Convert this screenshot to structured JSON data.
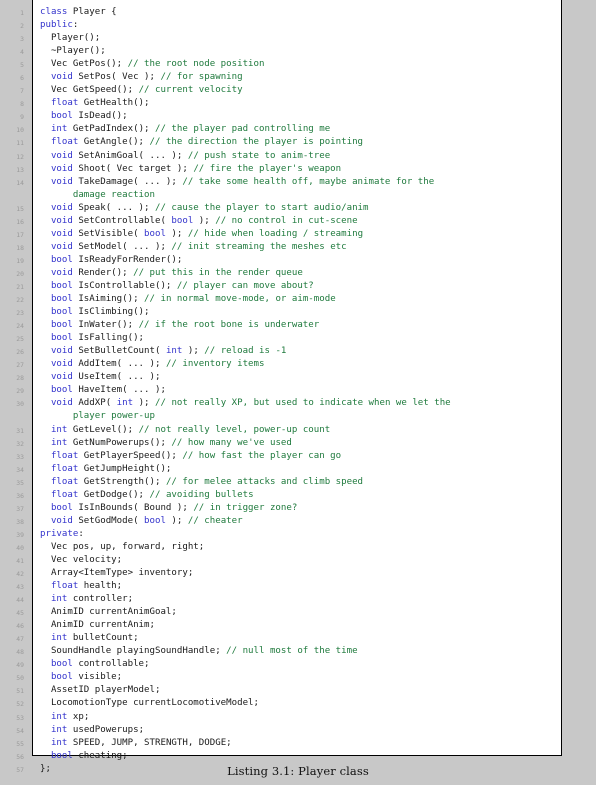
{
  "document": {
    "type": "code-listing",
    "language": "cpp",
    "caption": "Listing 3.1: Player class",
    "caption_label": "Listing 3.1:",
    "caption_title": "Player class",
    "page_background": "#c8c8c8",
    "listing_background": "#ffffff",
    "keyword_color": "#3333cc",
    "comment_color": "#1f7a3d",
    "text_color": "#1a1a1a",
    "lineno_color": "#9a9a9a",
    "first_line_number": 1,
    "last_line_number": 57
  },
  "code": {
    "lines": [
      {
        "n": "1",
        "tokens": [
          {
            "t": "kw",
            "s": "class"
          },
          {
            "t": "pl",
            "s": " Player {"
          }
        ]
      },
      {
        "n": "2",
        "tokens": [
          {
            "t": "kw",
            "s": "public"
          },
          {
            "t": "pl",
            "s": ":"
          }
        ]
      },
      {
        "n": "3",
        "tokens": [
          {
            "t": "pl",
            "s": "  Player();"
          }
        ]
      },
      {
        "n": "4",
        "tokens": [
          {
            "t": "pl",
            "s": "  ~Player();"
          }
        ]
      },
      {
        "n": "5",
        "tokens": [
          {
            "t": "pl",
            "s": "  Vec GetPos(); "
          },
          {
            "t": "cm",
            "s": "// the root node position"
          }
        ]
      },
      {
        "n": "6",
        "tokens": [
          {
            "t": "pl",
            "s": "  "
          },
          {
            "t": "kw",
            "s": "void"
          },
          {
            "t": "pl",
            "s": " SetPos( Vec ); "
          },
          {
            "t": "cm",
            "s": "// for spawning"
          }
        ]
      },
      {
        "n": "7",
        "tokens": [
          {
            "t": "pl",
            "s": "  Vec GetSpeed(); "
          },
          {
            "t": "cm",
            "s": "// current velocity"
          }
        ]
      },
      {
        "n": "8",
        "tokens": [
          {
            "t": "pl",
            "s": "  "
          },
          {
            "t": "kw",
            "s": "float"
          },
          {
            "t": "pl",
            "s": " GetHealth();"
          }
        ]
      },
      {
        "n": "9",
        "tokens": [
          {
            "t": "pl",
            "s": "  "
          },
          {
            "t": "kw",
            "s": "bool"
          },
          {
            "t": "pl",
            "s": " IsDead();"
          }
        ]
      },
      {
        "n": "10",
        "tokens": [
          {
            "t": "pl",
            "s": "  "
          },
          {
            "t": "kw",
            "s": "int"
          },
          {
            "t": "pl",
            "s": " GetPadIndex(); "
          },
          {
            "t": "cm",
            "s": "// the player pad controlling me"
          }
        ]
      },
      {
        "n": "11",
        "tokens": [
          {
            "t": "pl",
            "s": "  "
          },
          {
            "t": "kw",
            "s": "float"
          },
          {
            "t": "pl",
            "s": " GetAngle(); "
          },
          {
            "t": "cm",
            "s": "// the direction the player is pointing"
          }
        ]
      },
      {
        "n": "12",
        "tokens": [
          {
            "t": "pl",
            "s": "  "
          },
          {
            "t": "kw",
            "s": "void"
          },
          {
            "t": "pl",
            "s": " SetAnimGoal( ... ); "
          },
          {
            "t": "cm",
            "s": "// push state to anim-tree"
          }
        ]
      },
      {
        "n": "13",
        "tokens": [
          {
            "t": "pl",
            "s": "  "
          },
          {
            "t": "kw",
            "s": "void"
          },
          {
            "t": "pl",
            "s": " Shoot( Vec target ); "
          },
          {
            "t": "cm",
            "s": "// fire the player's weapon"
          }
        ]
      },
      {
        "n": "14",
        "tokens": [
          {
            "t": "pl",
            "s": "  "
          },
          {
            "t": "kw",
            "s": "void"
          },
          {
            "t": "pl",
            "s": " TakeDamage( ... ); "
          },
          {
            "t": "cm",
            "s": "// take some health off, maybe animate for the"
          }
        ]
      },
      {
        "n": "",
        "tokens": [
          {
            "t": "cm",
            "s": "      damage reaction"
          }
        ]
      },
      {
        "n": "15",
        "tokens": [
          {
            "t": "pl",
            "s": "  "
          },
          {
            "t": "kw",
            "s": "void"
          },
          {
            "t": "pl",
            "s": " Speak( ... ); "
          },
          {
            "t": "cm",
            "s": "// cause the player to start audio/anim"
          }
        ]
      },
      {
        "n": "16",
        "tokens": [
          {
            "t": "pl",
            "s": "  "
          },
          {
            "t": "kw",
            "s": "void"
          },
          {
            "t": "pl",
            "s": " SetControllable( "
          },
          {
            "t": "kw",
            "s": "bool"
          },
          {
            "t": "pl",
            "s": " ); "
          },
          {
            "t": "cm",
            "s": "// no control in cut-scene"
          }
        ]
      },
      {
        "n": "17",
        "tokens": [
          {
            "t": "pl",
            "s": "  "
          },
          {
            "t": "kw",
            "s": "void"
          },
          {
            "t": "pl",
            "s": " SetVisible( "
          },
          {
            "t": "kw",
            "s": "bool"
          },
          {
            "t": "pl",
            "s": " ); "
          },
          {
            "t": "cm",
            "s": "// hide when loading / streaming"
          }
        ]
      },
      {
        "n": "18",
        "tokens": [
          {
            "t": "pl",
            "s": "  "
          },
          {
            "t": "kw",
            "s": "void"
          },
          {
            "t": "pl",
            "s": " SetModel( ... ); "
          },
          {
            "t": "cm",
            "s": "// init streaming the meshes etc"
          }
        ]
      },
      {
        "n": "19",
        "tokens": [
          {
            "t": "pl",
            "s": "  "
          },
          {
            "t": "kw",
            "s": "bool"
          },
          {
            "t": "pl",
            "s": " IsReadyForRender();"
          }
        ]
      },
      {
        "n": "20",
        "tokens": [
          {
            "t": "pl",
            "s": "  "
          },
          {
            "t": "kw",
            "s": "void"
          },
          {
            "t": "pl",
            "s": " Render(); "
          },
          {
            "t": "cm",
            "s": "// put this in the render queue"
          }
        ]
      },
      {
        "n": "21",
        "tokens": [
          {
            "t": "pl",
            "s": "  "
          },
          {
            "t": "kw",
            "s": "bool"
          },
          {
            "t": "pl",
            "s": " IsControllable(); "
          },
          {
            "t": "cm",
            "s": "// player can move about?"
          }
        ]
      },
      {
        "n": "22",
        "tokens": [
          {
            "t": "pl",
            "s": "  "
          },
          {
            "t": "kw",
            "s": "bool"
          },
          {
            "t": "pl",
            "s": " IsAiming(); "
          },
          {
            "t": "cm",
            "s": "// in normal move-mode, or aim-mode"
          }
        ]
      },
      {
        "n": "23",
        "tokens": [
          {
            "t": "pl",
            "s": "  "
          },
          {
            "t": "kw",
            "s": "bool"
          },
          {
            "t": "pl",
            "s": " IsClimbing();"
          }
        ]
      },
      {
        "n": "24",
        "tokens": [
          {
            "t": "pl",
            "s": "  "
          },
          {
            "t": "kw",
            "s": "bool"
          },
          {
            "t": "pl",
            "s": " InWater(); "
          },
          {
            "t": "cm",
            "s": "// if the root bone is underwater"
          }
        ]
      },
      {
        "n": "25",
        "tokens": [
          {
            "t": "pl",
            "s": "  "
          },
          {
            "t": "kw",
            "s": "bool"
          },
          {
            "t": "pl",
            "s": " IsFalling();"
          }
        ]
      },
      {
        "n": "26",
        "tokens": [
          {
            "t": "pl",
            "s": "  "
          },
          {
            "t": "kw",
            "s": "void"
          },
          {
            "t": "pl",
            "s": " SetBulletCount( "
          },
          {
            "t": "kw",
            "s": "int"
          },
          {
            "t": "pl",
            "s": " ); "
          },
          {
            "t": "cm",
            "s": "// reload is -1"
          }
        ]
      },
      {
        "n": "27",
        "tokens": [
          {
            "t": "pl",
            "s": "  "
          },
          {
            "t": "kw",
            "s": "void"
          },
          {
            "t": "pl",
            "s": " AddItem( ... ); "
          },
          {
            "t": "cm",
            "s": "// inventory items"
          }
        ]
      },
      {
        "n": "28",
        "tokens": [
          {
            "t": "pl",
            "s": "  "
          },
          {
            "t": "kw",
            "s": "void"
          },
          {
            "t": "pl",
            "s": " UseItem( ... );"
          }
        ]
      },
      {
        "n": "29",
        "tokens": [
          {
            "t": "pl",
            "s": "  "
          },
          {
            "t": "kw",
            "s": "bool"
          },
          {
            "t": "pl",
            "s": " HaveItem( ... );"
          }
        ]
      },
      {
        "n": "30",
        "tokens": [
          {
            "t": "pl",
            "s": "  "
          },
          {
            "t": "kw",
            "s": "void"
          },
          {
            "t": "pl",
            "s": " AddXP( "
          },
          {
            "t": "kw",
            "s": "int"
          },
          {
            "t": "pl",
            "s": " ); "
          },
          {
            "t": "cm",
            "s": "// not really XP, but used to indicate when we let the"
          }
        ]
      },
      {
        "n": "",
        "tokens": [
          {
            "t": "cm",
            "s": "      player power-up"
          }
        ]
      },
      {
        "n": "31",
        "tokens": [
          {
            "t": "pl",
            "s": "  "
          },
          {
            "t": "kw",
            "s": "int"
          },
          {
            "t": "pl",
            "s": " GetLevel(); "
          },
          {
            "t": "cm",
            "s": "// not really level, power-up count"
          }
        ]
      },
      {
        "n": "32",
        "tokens": [
          {
            "t": "pl",
            "s": "  "
          },
          {
            "t": "kw",
            "s": "int"
          },
          {
            "t": "pl",
            "s": " GetNumPowerups(); "
          },
          {
            "t": "cm",
            "s": "// how many we've used"
          }
        ]
      },
      {
        "n": "33",
        "tokens": [
          {
            "t": "pl",
            "s": "  "
          },
          {
            "t": "kw",
            "s": "float"
          },
          {
            "t": "pl",
            "s": " GetPlayerSpeed(); "
          },
          {
            "t": "cm",
            "s": "// how fast the player can go"
          }
        ]
      },
      {
        "n": "34",
        "tokens": [
          {
            "t": "pl",
            "s": "  "
          },
          {
            "t": "kw",
            "s": "float"
          },
          {
            "t": "pl",
            "s": " GetJumpHeight();"
          }
        ]
      },
      {
        "n": "35",
        "tokens": [
          {
            "t": "pl",
            "s": "  "
          },
          {
            "t": "kw",
            "s": "float"
          },
          {
            "t": "pl",
            "s": " GetStrength(); "
          },
          {
            "t": "cm",
            "s": "// for melee attacks and climb speed"
          }
        ]
      },
      {
        "n": "36",
        "tokens": [
          {
            "t": "pl",
            "s": "  "
          },
          {
            "t": "kw",
            "s": "float"
          },
          {
            "t": "pl",
            "s": " GetDodge(); "
          },
          {
            "t": "cm",
            "s": "// avoiding bullets"
          }
        ]
      },
      {
        "n": "37",
        "tokens": [
          {
            "t": "pl",
            "s": "  "
          },
          {
            "t": "kw",
            "s": "bool"
          },
          {
            "t": "pl",
            "s": " IsInBounds( Bound ); "
          },
          {
            "t": "cm",
            "s": "// in trigger zone?"
          }
        ]
      },
      {
        "n": "38",
        "tokens": [
          {
            "t": "pl",
            "s": "  "
          },
          {
            "t": "kw",
            "s": "void"
          },
          {
            "t": "pl",
            "s": " SetGodMode( "
          },
          {
            "t": "kw",
            "s": "bool"
          },
          {
            "t": "pl",
            "s": " ); "
          },
          {
            "t": "cm",
            "s": "// cheater"
          }
        ]
      },
      {
        "n": "39",
        "tokens": [
          {
            "t": "kw",
            "s": "private"
          },
          {
            "t": "pl",
            "s": ":"
          }
        ]
      },
      {
        "n": "40",
        "tokens": [
          {
            "t": "pl",
            "s": "  Vec pos, up, forward, right;"
          }
        ]
      },
      {
        "n": "41",
        "tokens": [
          {
            "t": "pl",
            "s": "  Vec velocity;"
          }
        ]
      },
      {
        "n": "42",
        "tokens": [
          {
            "t": "pl",
            "s": "  Array<ItemType> inventory;"
          }
        ]
      },
      {
        "n": "43",
        "tokens": [
          {
            "t": "pl",
            "s": "  "
          },
          {
            "t": "kw",
            "s": "float"
          },
          {
            "t": "pl",
            "s": " health;"
          }
        ]
      },
      {
        "n": "44",
        "tokens": [
          {
            "t": "pl",
            "s": "  "
          },
          {
            "t": "kw",
            "s": "int"
          },
          {
            "t": "pl",
            "s": " controller;"
          }
        ]
      },
      {
        "n": "45",
        "tokens": [
          {
            "t": "pl",
            "s": "  AnimID currentAnimGoal;"
          }
        ]
      },
      {
        "n": "46",
        "tokens": [
          {
            "t": "pl",
            "s": "  AnimID currentAnim;"
          }
        ]
      },
      {
        "n": "47",
        "tokens": [
          {
            "t": "pl",
            "s": "  "
          },
          {
            "t": "kw",
            "s": "int"
          },
          {
            "t": "pl",
            "s": " bulletCount;"
          }
        ]
      },
      {
        "n": "48",
        "tokens": [
          {
            "t": "pl",
            "s": "  SoundHandle playingSoundHandle; "
          },
          {
            "t": "cm",
            "s": "// null most of the time"
          }
        ]
      },
      {
        "n": "49",
        "tokens": [
          {
            "t": "pl",
            "s": "  "
          },
          {
            "t": "kw",
            "s": "bool"
          },
          {
            "t": "pl",
            "s": " controllable;"
          }
        ]
      },
      {
        "n": "50",
        "tokens": [
          {
            "t": "pl",
            "s": "  "
          },
          {
            "t": "kw",
            "s": "bool"
          },
          {
            "t": "pl",
            "s": " visible;"
          }
        ]
      },
      {
        "n": "51",
        "tokens": [
          {
            "t": "pl",
            "s": "  AssetID playerModel;"
          }
        ]
      },
      {
        "n": "52",
        "tokens": [
          {
            "t": "pl",
            "s": "  LocomotionType currentLocomotiveModel;"
          }
        ]
      },
      {
        "n": "53",
        "tokens": [
          {
            "t": "pl",
            "s": "  "
          },
          {
            "t": "kw",
            "s": "int"
          },
          {
            "t": "pl",
            "s": " xp;"
          }
        ]
      },
      {
        "n": "54",
        "tokens": [
          {
            "t": "pl",
            "s": "  "
          },
          {
            "t": "kw",
            "s": "int"
          },
          {
            "t": "pl",
            "s": " usedPowerups;"
          }
        ]
      },
      {
        "n": "55",
        "tokens": [
          {
            "t": "pl",
            "s": "  "
          },
          {
            "t": "kw",
            "s": "int"
          },
          {
            "t": "pl",
            "s": " SPEED, JUMP, STRENGTH, DODGE;"
          }
        ]
      },
      {
        "n": "56",
        "tokens": [
          {
            "t": "pl",
            "s": "  "
          },
          {
            "t": "kw",
            "s": "bool"
          },
          {
            "t": "pl",
            "s": " cheating;"
          }
        ]
      },
      {
        "n": "57",
        "tokens": [
          {
            "t": "pl",
            "s": "};"
          }
        ]
      }
    ]
  }
}
